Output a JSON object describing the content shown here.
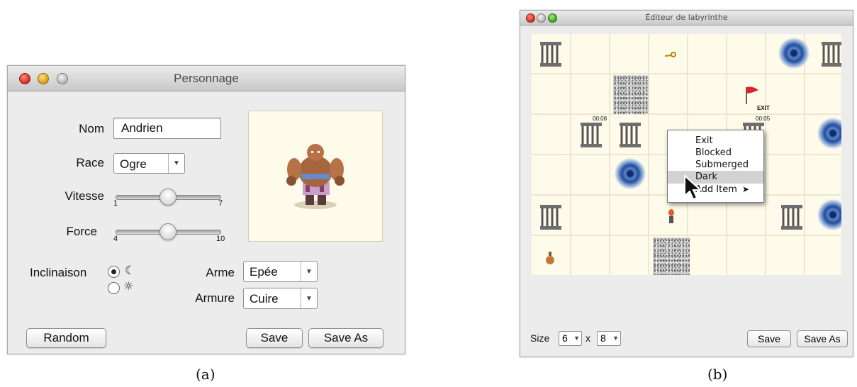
{
  "left_window": {
    "title": "Personnage",
    "labels": {
      "name": "Nom",
      "race": "Race",
      "speed": "Vitesse",
      "strength": "Force",
      "alignment": "Inclinaison",
      "weapon": "Arme",
      "armor": "Armure"
    },
    "name_value": "Andrien",
    "race_value": "Ogre",
    "speed_slider": {
      "min": "1",
      "max": "7",
      "value": 4
    },
    "strength_slider": {
      "min": "4",
      "max": "10",
      "value": 7
    },
    "alignment_options": [
      {
        "icon": "moon-icon",
        "selected": true
      },
      {
        "icon": "sun-icon",
        "selected": false
      }
    ],
    "weapon_value": "Epée",
    "armor_value": "Cuire",
    "buttons": {
      "random": "Random",
      "save": "Save",
      "save_as": "Save As"
    },
    "caption": "(a)"
  },
  "right_window": {
    "title": "Éditeur de labyrinthe",
    "timers": [
      "00:08",
      "00:05"
    ],
    "exit_label": "EXIT",
    "context_menu": {
      "items": [
        "Exit",
        "Blocked",
        "Submerged",
        "Dark",
        "Add Item"
      ],
      "highlighted": "Dark"
    },
    "size_label": "Size",
    "size_rows": "6",
    "size_times": "x",
    "size_cols": "8",
    "buttons": {
      "save": "Save",
      "save_as": "Save As"
    },
    "caption": "(b)"
  },
  "colors": {
    "board_bg": "#fffbeb",
    "window_bg": "#ececec",
    "exit_flag": "#d8262b"
  }
}
